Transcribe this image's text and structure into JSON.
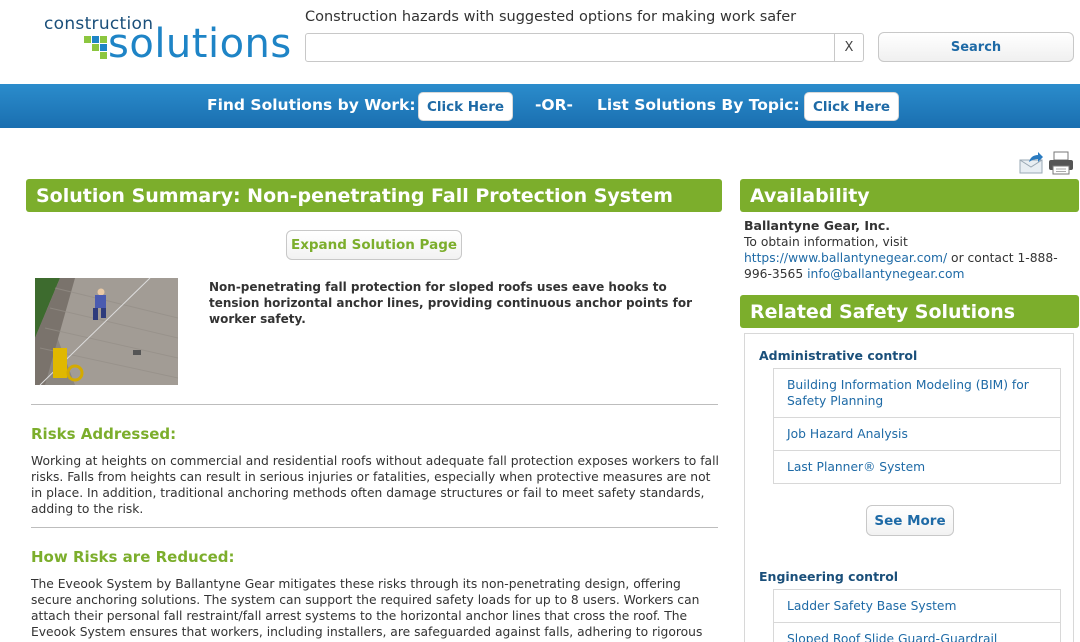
{
  "header": {
    "logo_top": "construction",
    "logo_bottom": "solutions",
    "tagline": "Construction hazards with suggested options for making work safer",
    "search_value": "",
    "clear_label": "X",
    "search_label": "Search"
  },
  "nav": {
    "find_by_work_label": "Find Solutions by Work:",
    "find_by_work_button": "Click Here",
    "or_label": "-OR-",
    "by_topic_label": "List Solutions By Topic:",
    "by_topic_button": "Click Here"
  },
  "main": {
    "title": "Solution Summary: Non-penetrating Fall Protection System",
    "expand_label": "Expand Solution Page",
    "summary": "Non-penetrating fall protection for sloped roofs uses eave hooks to tension horizontal anchor lines, providing continuous anchor points for worker safety.",
    "risks_heading": "Risks Addressed:",
    "risks_text": "Working at heights on commercial and residential roofs without adequate fall protection exposes workers to fall risks. Falls from heights can result in serious injuries or fatalities, especially when protective measures are not in place. In addition, traditional anchoring methods often damage structures or fail to meet safety standards, adding to the risk.",
    "reduced_heading": "How Risks are Reduced:",
    "reduced_text": "The Eveook System by Ballantyne Gear mitigates these risks through its non-penetrating design, offering secure anchoring solutions. The system can support the required safety loads for up to 8 users. Workers can attach their personal fall restraint/fall arrest systems to the horizontal anchor lines that cross the roof. The Eveook System ensures that workers, including installers, are safeguarded against falls, adhering to rigorous safety standards and"
  },
  "availability": {
    "heading": "Availability",
    "company": "Ballantyne Gear, Inc.",
    "line1": "To obtain information, visit",
    "url": "https://www.ballantynegear.com/",
    "contact_prefix": " or contact 1-888-996-3565 ",
    "email": "info@ballantynegear.com"
  },
  "related": {
    "heading": "Related Safety Solutions",
    "groups": [
      {
        "title": "Administrative control",
        "items": [
          "Building Information Modeling (BIM) for Safety Planning",
          "Job Hazard Analysis",
          "Last Planner® System"
        ],
        "see_more": "See More"
      },
      {
        "title": "Engineering control",
        "items": [
          "Ladder Safety Base System",
          "Sloped Roof Slide Guard-Guardrail System"
        ]
      }
    ]
  },
  "colors": {
    "green": "#7cae2c",
    "blue": "#1e6aa6",
    "nav_blue": "#1a6fb0"
  }
}
